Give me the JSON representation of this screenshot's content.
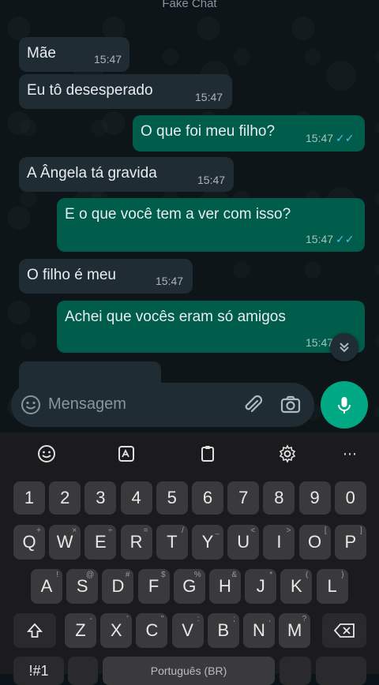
{
  "header": {
    "title": "Fake Chat"
  },
  "messages": [
    {
      "dir": "in",
      "text": "Mãe",
      "time": "15:47"
    },
    {
      "dir": "in",
      "text": "Eu tô desesperado",
      "time": "15:47"
    },
    {
      "dir": "out",
      "text": "O que foi meu filho?",
      "time": "15:47"
    },
    {
      "dir": "in",
      "text": "A Ângela tá gravida",
      "time": "15:47"
    },
    {
      "dir": "out",
      "text": "E o que você tem a ver com isso?",
      "time": "15:47"
    },
    {
      "dir": "in",
      "text": "O filho é meu",
      "time": "15:47"
    },
    {
      "dir": "out",
      "text": "Achei que vocês eram só amigos",
      "time": "15:47"
    }
  ],
  "composer": {
    "placeholder": "Mensagem"
  },
  "icons": {
    "emoji": "emoji-icon",
    "attach": "paperclip-icon",
    "camera": "camera-icon",
    "mic": "mic-icon",
    "scroll": "double-chevron-down-icon",
    "read": "double-check-icon"
  },
  "colors": {
    "incoming": "#1f2c34",
    "outgoing": "#005c4b",
    "accent": "#00a884",
    "ticks": "#53bdeb"
  },
  "keyboard": {
    "number_row": [
      "1",
      "2",
      "3",
      "4",
      "5",
      "6",
      "7",
      "8",
      "9",
      "0"
    ],
    "row1": [
      {
        "k": "Q",
        "h": "+"
      },
      {
        "k": "W",
        "h": "×"
      },
      {
        "k": "E",
        "h": "÷"
      },
      {
        "k": "R",
        "h": "="
      },
      {
        "k": "T",
        "h": "/"
      },
      {
        "k": "Y",
        "h": "_"
      },
      {
        "k": "U",
        "h": "<"
      },
      {
        "k": "I",
        "h": ">"
      },
      {
        "k": "O",
        "h": "["
      },
      {
        "k": "P",
        "h": "]"
      }
    ],
    "row2": [
      {
        "k": "A",
        "h": "!"
      },
      {
        "k": "S",
        "h": "@"
      },
      {
        "k": "D",
        "h": "#"
      },
      {
        "k": "F",
        "h": "$"
      },
      {
        "k": "G",
        "h": "%"
      },
      {
        "k": "H",
        "h": "&"
      },
      {
        "k": "J",
        "h": "*"
      },
      {
        "k": "K",
        "h": "("
      },
      {
        "k": "L",
        "h": ")"
      }
    ],
    "row3": [
      {
        "k": "Z",
        "h": "-"
      },
      {
        "k": "X",
        "h": "'"
      },
      {
        "k": "C",
        "h": "\""
      },
      {
        "k": "V",
        "h": ":"
      },
      {
        "k": "B",
        "h": ";"
      },
      {
        "k": "N",
        "h": ","
      },
      {
        "k": "M",
        "h": "?"
      }
    ],
    "symbols_label": "!#1",
    "space_label": "Português (BR)"
  }
}
